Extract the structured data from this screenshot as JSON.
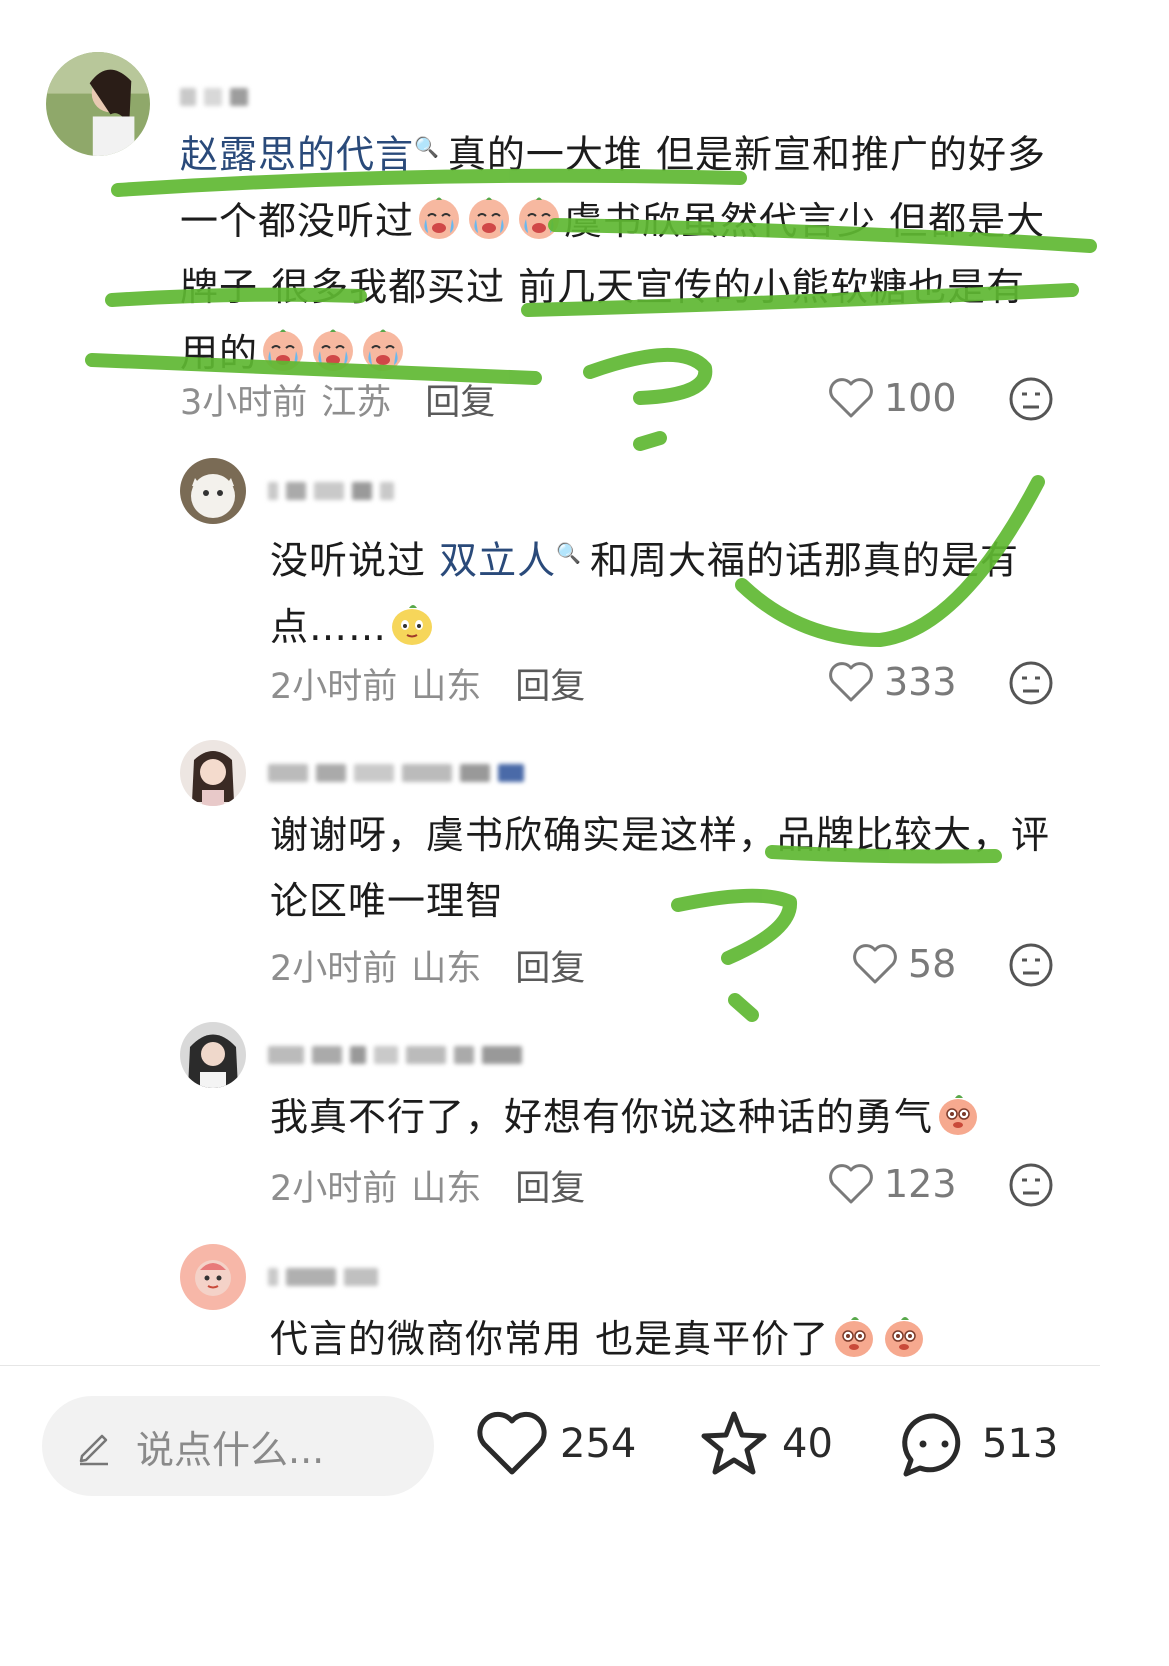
{
  "comments": [
    {
      "mention": "赵露思的代言",
      "text_parts": [
        "真的一大堆 但是新宣和推广的好多",
        "一个都没听过",
        "虞书欣虽然代言少 但都是大",
        "牌子 很多我都买过 前几天宣传的小熊软糖也是有",
        "用的"
      ],
      "time": "3小时前",
      "location": "江苏",
      "reply": "回复",
      "likes": "100"
    },
    {
      "text_before": "没听说过",
      "mention": "双立人",
      "text_after": "和周大福的话那真的是有",
      "line2": "点……",
      "time": "2小时前",
      "location": "山东",
      "reply": "回复",
      "likes": "333"
    },
    {
      "line1": "谢谢呀，虞书欣确实是这样，品牌比较大，评",
      "line2": "论区唯一理智",
      "time": "2小时前",
      "location": "山东",
      "reply": "回复",
      "likes": "58"
    },
    {
      "line1": "我真不行了，好想有你说这种话的勇气",
      "time": "2小时前",
      "location": "山东",
      "reply": "回复",
      "likes": "123"
    },
    {
      "line1": "代言的微商你常用 也是真平价了"
    }
  ],
  "bottom_bar": {
    "input_placeholder": "说点什么...",
    "likes": "254",
    "stars": "40",
    "comments": "513"
  },
  "colors": {
    "mention": "#2a4a7a",
    "annotation": "#5fb832",
    "meta": "#8e8e8e"
  }
}
